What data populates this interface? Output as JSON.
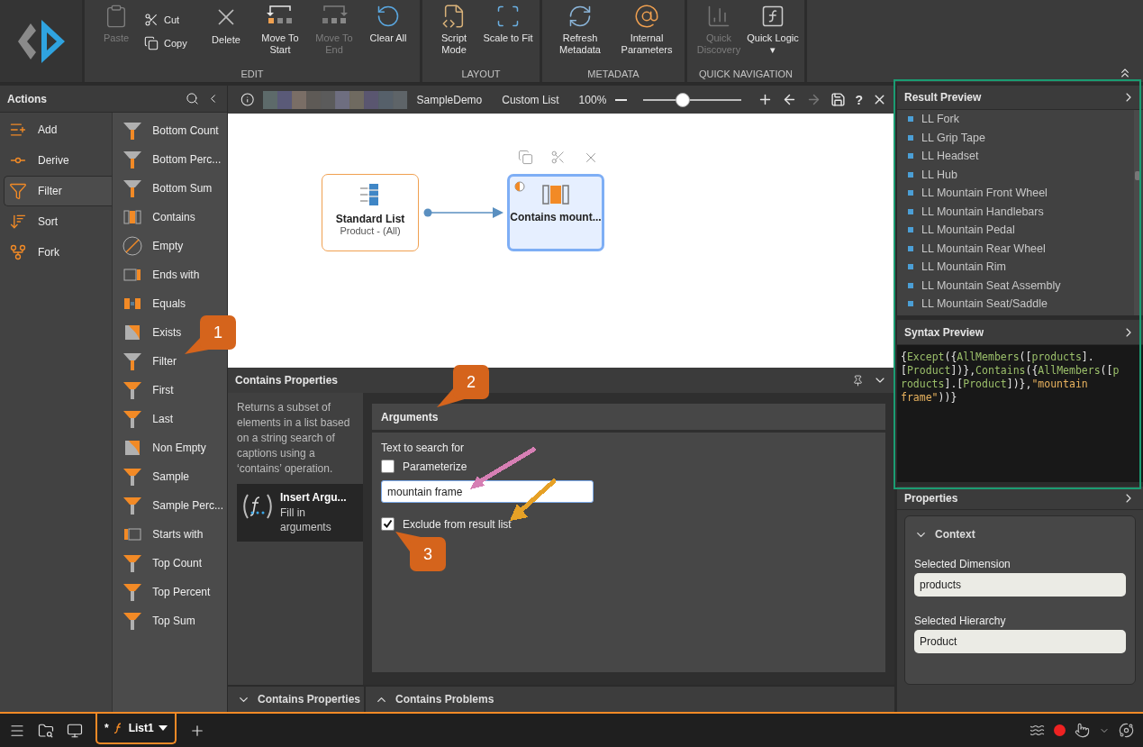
{
  "ribbon": {
    "groups": [
      {
        "label": "EDIT",
        "buttons": [
          {
            "label": "Paste",
            "kind": "large",
            "disabled": true
          },
          {
            "label": "Cut",
            "kind": "small",
            "disabled": false
          },
          {
            "label": "Copy",
            "kind": "small",
            "disabled": false
          },
          {
            "label": "Delete",
            "kind": "large",
            "disabled": false
          },
          {
            "label": "Move To Start",
            "kind": "large",
            "disabled": false
          },
          {
            "label": "Move To End",
            "kind": "large",
            "disabled": true
          },
          {
            "label": "Clear All",
            "kind": "large",
            "disabled": false
          }
        ]
      },
      {
        "label": "LAYOUT",
        "buttons": [
          {
            "label": "Script Mode",
            "kind": "large",
            "disabled": false
          },
          {
            "label": "Scale to Fit",
            "kind": "large",
            "disabled": false
          }
        ]
      },
      {
        "label": "METADATA",
        "buttons": [
          {
            "label": "Refresh Metadata",
            "kind": "large",
            "disabled": false
          },
          {
            "label": "Internal Parameters",
            "kind": "large",
            "disabled": false
          }
        ]
      },
      {
        "label": "QUICK NAVIGATION",
        "buttons": [
          {
            "label": "Quick Discovery",
            "kind": "large",
            "disabled": true
          },
          {
            "label": "Quick Logic ▾",
            "kind": "large",
            "disabled": false
          }
        ]
      }
    ]
  },
  "actions": {
    "title": "Actions",
    "categories": [
      {
        "label": "Add",
        "selected": false
      },
      {
        "label": "Derive",
        "selected": false
      },
      {
        "label": "Filter",
        "selected": true
      },
      {
        "label": "Sort",
        "selected": false
      },
      {
        "label": "Fork",
        "selected": false
      }
    ],
    "items": [
      {
        "label": "Bottom Count",
        "kind": "funnel-bottom"
      },
      {
        "label": "Bottom Perc...",
        "kind": "funnel-bottom"
      },
      {
        "label": "Bottom Sum",
        "kind": "funnel-bottom"
      },
      {
        "label": "Contains",
        "kind": "contains"
      },
      {
        "label": "Empty",
        "kind": "empty"
      },
      {
        "label": "Ends with",
        "kind": "ends"
      },
      {
        "label": "Equals",
        "kind": "equals"
      },
      {
        "label": "Exists",
        "kind": "exists"
      },
      {
        "label": "Filter",
        "kind": "funnel-bottom"
      },
      {
        "label": "First",
        "kind": "funnel-top"
      },
      {
        "label": "Last",
        "kind": "funnel-top"
      },
      {
        "label": "Non Empty",
        "kind": "exists"
      },
      {
        "label": "Sample",
        "kind": "funnel-top"
      },
      {
        "label": "Sample Perc...",
        "kind": "funnel-top"
      },
      {
        "label": "Starts with",
        "kind": "starts"
      },
      {
        "label": "Top Count",
        "kind": "funnel-top"
      },
      {
        "label": "Top Percent",
        "kind": "funnel-top"
      },
      {
        "label": "Top Sum",
        "kind": "funnel-top"
      }
    ]
  },
  "editor": {
    "title": "SampleDemo",
    "view": "Custom List",
    "zoom": "100%",
    "zoom_slider": {
      "level": 0.4
    },
    "back_disabled": false,
    "forward_disabled": true,
    "help": "?"
  },
  "canvas": {
    "nodes": [
      {
        "title": "Standard List",
        "subtitle": "Product - (All)",
        "kind": "list",
        "selected": false
      },
      {
        "title": "Contains mount...",
        "kind": "contains",
        "selected": true
      }
    ]
  },
  "properties_panel": {
    "title": "Contains Properties",
    "description": "Returns a subset of elements in a list based on a string search of captions using a ‘contains’ operation.",
    "step": {
      "title": "Insert Argu...",
      "subtitle": "Fill in arguments"
    },
    "section": "Arguments",
    "field_label": "Text to search for",
    "parameterize": {
      "label": "Parameterize",
      "checked": false
    },
    "search_value": "mountain frame",
    "exclude": {
      "label": "Exclude from result list",
      "checked": true
    }
  },
  "bottom_tabs": [
    {
      "label": "Contains Properties",
      "expanded": true
    },
    {
      "label": "Contains Problems",
      "expanded": false
    }
  ],
  "result_preview": {
    "title": "Result Preview",
    "items": [
      "LL Fork",
      "LL Grip Tape",
      "LL Headset",
      "LL Hub",
      "LL Mountain Front Wheel",
      "LL Mountain Handlebars",
      "LL Mountain Pedal",
      "LL Mountain Rear Wheel",
      "LL Mountain Rim",
      "LL Mountain Seat Assembly",
      "LL Mountain Seat/Saddle"
    ]
  },
  "syntax_preview": {
    "title": "Syntax Preview",
    "lines": [
      [
        {
          "kind": "punct",
          "text": "{"
        },
        {
          "kind": "name",
          "text": "Except"
        },
        {
          "kind": "punct",
          "text": "({"
        },
        {
          "kind": "name",
          "text": "AllMembers"
        },
        {
          "kind": "punct",
          "text": "(["
        },
        {
          "kind": "name",
          "text": "products"
        },
        {
          "kind": "punct",
          "text": "]."
        }
      ],
      [
        {
          "kind": "punct",
          "text": "["
        },
        {
          "kind": "name",
          "text": "Product"
        },
        {
          "kind": "punct",
          "text": "])},"
        },
        {
          "kind": "name",
          "text": "Contains"
        },
        {
          "kind": "punct",
          "text": "({"
        },
        {
          "kind": "name",
          "text": "AllMembers"
        },
        {
          "kind": "punct",
          "text": "(["
        },
        {
          "kind": "name",
          "text": "p"
        }
      ],
      [
        {
          "kind": "name",
          "text": "roducts"
        },
        {
          "kind": "punct",
          "text": "].["
        },
        {
          "kind": "name",
          "text": "Product"
        },
        {
          "kind": "punct",
          "text": "])},"
        },
        {
          "kind": "string",
          "text": "\"mountain"
        }
      ],
      [
        {
          "kind": "string",
          "text": "frame\""
        },
        {
          "kind": "punct",
          "text": "))}"
        }
      ]
    ]
  },
  "properties": {
    "title": "Properties",
    "section": "Context",
    "expanded": true,
    "fields": [
      {
        "label": "Selected Dimension",
        "value": "products"
      },
      {
        "label": "Selected Hierarchy",
        "value": "Product"
      }
    ]
  },
  "taskbar": {
    "tabs": [
      {
        "modified": "*",
        "label": "List1",
        "selected": true
      }
    ]
  },
  "callouts": [
    {
      "text": "1"
    },
    {
      "text": "2"
    },
    {
      "text": "3"
    }
  ],
  "arrows": [
    {
      "color": "#d67fb4"
    },
    {
      "color": "#e6a126"
    }
  ],
  "highlight_frame": {
    "color": "#1b9c72"
  }
}
